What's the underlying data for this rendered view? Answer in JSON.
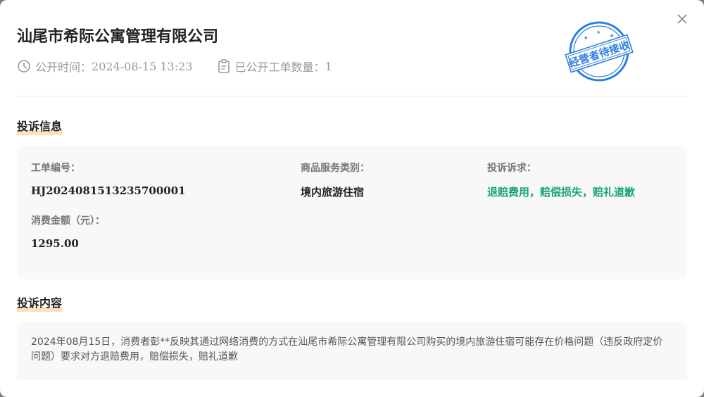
{
  "modal": {
    "title": "汕尾市希际公寓管理有限公司",
    "publish_time_label": "公开时间：",
    "publish_time": "2024-08-15 13:23",
    "orders_count_label": "已公开工单数量：",
    "orders_count": "1",
    "stamp_text": "经营者待接收",
    "stamp_color": "#2f7fe0"
  },
  "complaint_info": {
    "section_title": "投诉信息",
    "order_no_label": "工单编号：",
    "order_no": "HJ2024081513235700001",
    "category_label": "商品服务类别：",
    "category": "境内旅游住宿",
    "demand_label": "投诉诉求：",
    "demand": "退赔费用，赔偿损失，赔礼道歉",
    "amount_label": "消费金额（元）：",
    "amount": "1295.00"
  },
  "complaint_content": {
    "section_title": "投诉内容",
    "text": "2024年08月15日，消费者彭**反映其通过网络消费的方式在汕尾市希际公寓管理有限公司购买的境内旅游住宿可能存在价格问题（违反政府定价问题）要求对方退赔费用，赔偿损失，赔礼道歉"
  },
  "icons": {
    "close": "close-icon",
    "clock": "clock-icon",
    "clipboard": "clipboard-icon"
  },
  "colors": {
    "accent_green": "#15a37d",
    "highlight": "#fde3bd"
  }
}
